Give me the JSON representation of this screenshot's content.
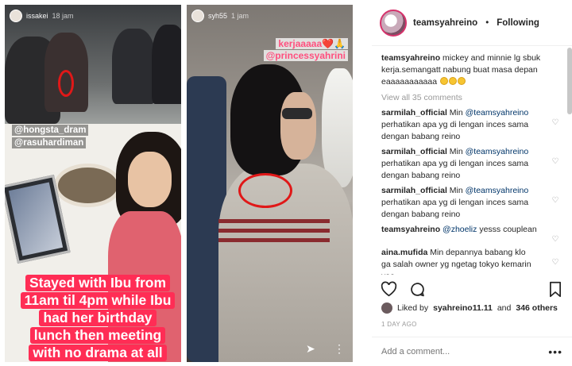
{
  "story_left": {
    "username": "issakei",
    "time": "18 jam",
    "tags": [
      "@hongsta_dram",
      "@rasuhardiman"
    ],
    "caption_lines": [
      "Stayed with Ibu from",
      "11am til 4pm while Ibu",
      "had her birthday",
      "lunch then meeting",
      "with no drama at all"
    ]
  },
  "story_mid": {
    "username": "syh55",
    "time": "1 jam",
    "text_line1": "kerjaaaaa❤️🙏",
    "text_line2": "@princessyahrini"
  },
  "post": {
    "username": "teamsyahreino",
    "separator": "•",
    "follow_label": "Following",
    "caption_user": "teamsyahreino",
    "caption_text": "mickey and minnie lg sbuk kerja.semangatt nabung buat masa depan eaaaaaaaaaaa",
    "view_all": "View all 35 comments",
    "comments": [
      {
        "user": "sarmilah_official",
        "pre": "Min",
        "mention": "@teamsyahreino",
        "text": "perhatikan apa yg di lengan inces sama dengan babang reino"
      },
      {
        "user": "sarmilah_official",
        "pre": "Min",
        "mention": "@teamsyahreino",
        "text": "perhatikan apa yg di lengan inces sama dengan babang reino"
      },
      {
        "user": "sarmilah_official",
        "pre": "Min",
        "mention": "@teamsyahreino",
        "text": "perhatikan apa yg di lengan inces sama dengan babang reino"
      },
      {
        "user": "teamsyahreino",
        "pre": "",
        "mention": "@zhoeliz",
        "text": "yesss couplean"
      },
      {
        "user": "aina.mufida",
        "pre": "Min depannya babang klo ga salah owner yg ngetag tokyo kemarin yaa",
        "mention": "",
        "text": ""
      }
    ],
    "likes_prefix": "Liked by",
    "likes_user": "syahreino11.11",
    "likes_and": "and",
    "likes_count": "346 others",
    "date": "1 DAY AGO",
    "add_comment_placeholder": "Add a comment...",
    "more_label": "•••"
  },
  "icons": {
    "heart": "heart-icon",
    "comment": "comment-icon",
    "bookmark": "bookmark-icon",
    "send": "send-icon",
    "more": "more-icon"
  },
  "colors": {
    "mention": "#003569",
    "caption_bg": "#ff2d55",
    "circle": "#e01818"
  }
}
